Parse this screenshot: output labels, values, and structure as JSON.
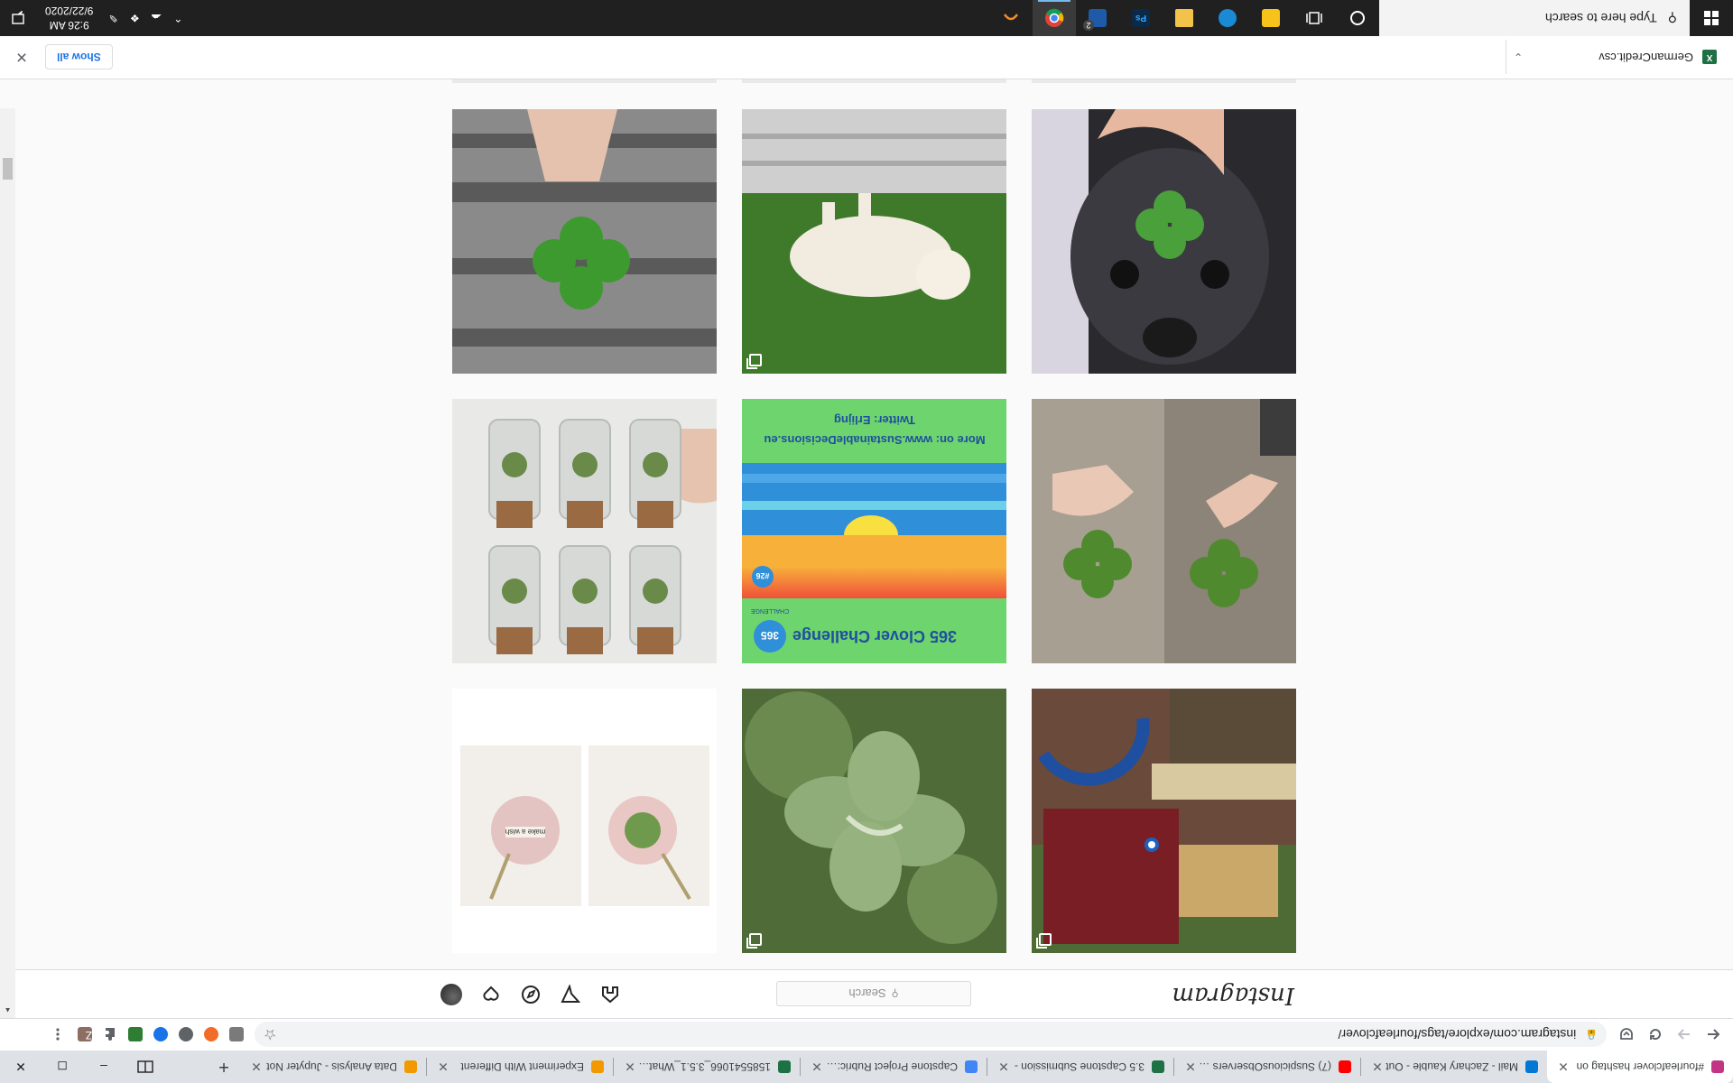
{
  "browser": {
    "tabs": [
      {
        "title": "#fourleafclover hashtag on",
        "favicon_color": "#c13584",
        "active": true
      },
      {
        "title": "Mail - Zachary Kauble - Out",
        "favicon_color": "#0078d4",
        "active": false
      },
      {
        "title": "(7) SuspiciousObservers - Yo",
        "favicon_color": "#ff0000",
        "active": false
      },
      {
        "title": "3.5 Capstone Submission -",
        "favicon_color": "#1e7145",
        "active": false
      },
      {
        "title": "Capstone Project Rubric: Da",
        "favicon_color": "#4285f4",
        "active": false
      },
      {
        "title": "1585541066_3.5.1_What_De",
        "favicon_color": "#1e7145",
        "active": false
      },
      {
        "title": "Experiment With Different",
        "favicon_color": "#f29900",
        "active": false
      },
      {
        "title": "Data Analysis - Jupyter Not",
        "favicon_color": "#f29900",
        "active": false
      }
    ],
    "new_tab_label": "+",
    "window_controls": {
      "minimize": "–",
      "maximize": "◻",
      "close": "✕"
    },
    "url": "instagram.com/explore/tags/fourleafclover/",
    "profile_initial": "Z"
  },
  "instagram": {
    "logo_text": "Instagram",
    "search_placeholder": "Search",
    "nav_icons": [
      "home-icon",
      "direct-icon",
      "explore-icon",
      "activity-icon",
      "profile-avatar"
    ],
    "tiles": [
      {
        "description_icon": "clover-photo",
        "multi": false
      },
      {
        "description_icon": "dog-photo",
        "multi": true
      },
      {
        "description_icon": "dog-clover-photo",
        "multi": false
      },
      {
        "description_icon": "clover-bottles-photo",
        "multi": false
      },
      {
        "description_icon": "challenge-poster",
        "multi": false
      },
      {
        "description_icon": "hands-clovers-photo",
        "multi": false
      },
      {
        "description_icon": "resin-pendant-photo",
        "multi": false
      },
      {
        "description_icon": "clover-patch-photo",
        "multi": true
      },
      {
        "description_icon": "horseshoe-photo",
        "multi": true
      }
    ],
    "poster": {
      "title": "365 Clover Challenge",
      "badge": "365",
      "badge_sub": "CHALLENGE",
      "day": "#26",
      "more": "More on: www.SustainableDecisions.eu",
      "twitter": "Twitter: Erlijng"
    },
    "pendant_text": "make a wish"
  },
  "downloads": {
    "file_name": "GermanCredit.csv",
    "show_all": "Show all",
    "close": "✕"
  },
  "taskbar": {
    "search_placeholder": "Type here to search",
    "time": "9:26 AM",
    "date": "9/22/2020",
    "notification_badge": "2"
  }
}
